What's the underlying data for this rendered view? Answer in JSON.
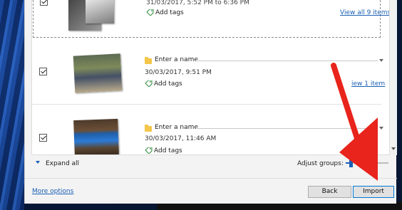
{
  "groups": [
    {
      "date": "31/03/2017, 5:52 PM to 6:36 PM",
      "add_tags": "Add tags",
      "view_link": "View all 9 items",
      "checked": true
    },
    {
      "name_placeholder": "Enter a name",
      "date": "30/03/2017, 9:51 PM",
      "add_tags": "Add tags",
      "view_link": "iew 1 item",
      "checked": true
    },
    {
      "name_placeholder": "Enter a name",
      "date": "30/03/2017, 11:46 AM",
      "add_tags": "Add tags",
      "view_link": "Vie",
      "checked": true
    }
  ],
  "footer": {
    "expand_all": "Expand all",
    "adjust_groups": "Adjust groups:",
    "adjust_groups_level": 0.12,
    "more_options": "More options",
    "back": "Back",
    "import": "Import"
  },
  "colors": {
    "link": "#1a5fb4",
    "annotation_arrow": "#e8241c",
    "folder": "#f4c64a"
  },
  "icons": [
    "folder-icon",
    "add-tag-icon",
    "checkbox-icon",
    "chevron-down-icon",
    "scroll-down-icon"
  ]
}
